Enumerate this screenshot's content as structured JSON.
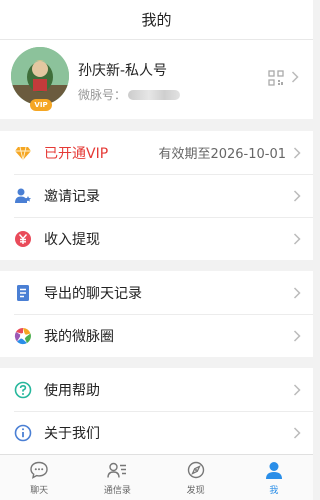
{
  "header": {
    "title": "我的"
  },
  "profile": {
    "name": "孙庆新-私人号",
    "id_label": "微脉号：",
    "vip_badge": "VIP"
  },
  "menu": {
    "vip": {
      "label": "已开通VIP",
      "value": "有效期至2026-10-01",
      "color": "#e53935"
    },
    "invite": {
      "label": "邀请记录"
    },
    "income": {
      "label": "收入提现"
    },
    "export": {
      "label": "导出的聊天记录"
    },
    "circle": {
      "label": "我的微脉圈"
    },
    "help": {
      "label": "使用帮助"
    },
    "about": {
      "label": "关于我们"
    }
  },
  "tabbar": {
    "active_color": "#2a8ee8",
    "items": [
      {
        "label": "聊天",
        "icon": "chat-icon"
      },
      {
        "label": "通信录",
        "icon": "contacts-icon"
      },
      {
        "label": "发现",
        "icon": "discover-icon"
      },
      {
        "label": "我",
        "icon": "me-icon"
      }
    ]
  }
}
